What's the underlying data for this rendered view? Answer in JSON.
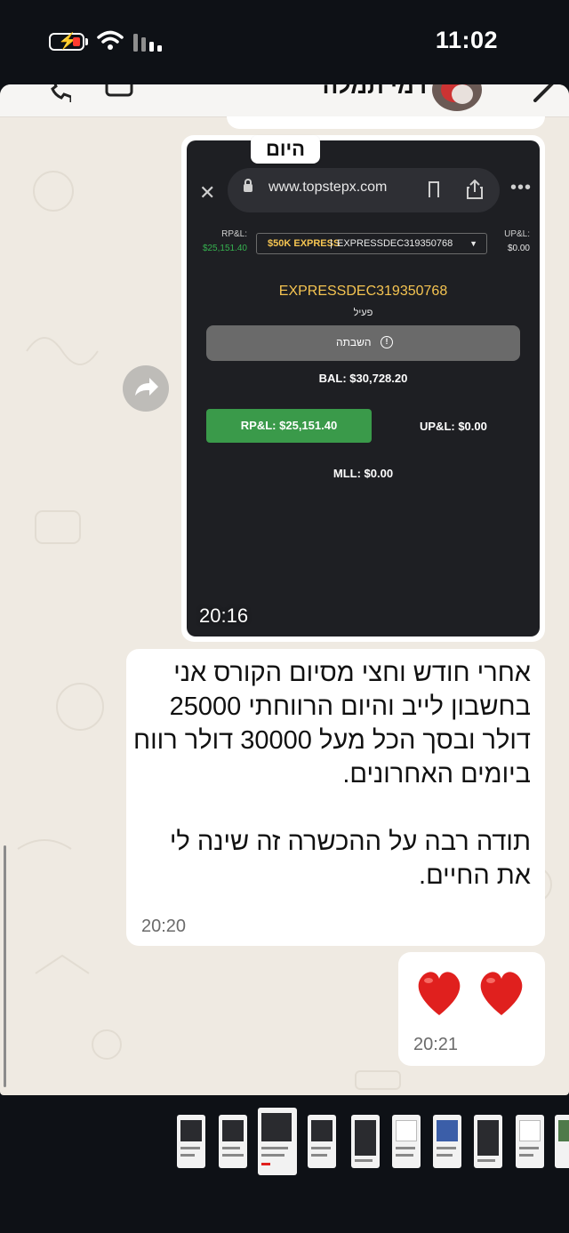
{
  "status_bar": {
    "time": "11:02"
  },
  "chat": {
    "contact_name": "רמי תמלה",
    "date_chip": "היום",
    "image_message": {
      "time": "20:16",
      "browser": {
        "url": "www.topstepx.com"
      },
      "topstep": {
        "rpl_label": "RP&L:",
        "rpl_value": "$25,151.40",
        "upl_label": "UP&L:",
        "upl_value": "$0.00",
        "account_badge": "$50K EXPRESS",
        "account_separator": "|",
        "account_id": "EXPRESSDEC319350768",
        "account_name": "EXPRESSDEC319350768",
        "account_status": "פעיל",
        "pause_label": "השבתה",
        "balance": "BAL: $30,728.20",
        "rpl_button": "RP&L: $25,151.40",
        "upl_main": "UP&L: $0.00",
        "mll": "MLL: $0.00"
      }
    },
    "text_message": {
      "text": "אחרי חודש וחצי מסיום הקורס אני בחשבון לייב והיום הרווחתי 25000 דולר ובסך הכל מעל 30000 דולר רווח ביומים האחרונים.\n\nתודה רבה על ההכשרה זה שינה לי את החיים.",
      "time": "20:20"
    },
    "hearts_message": {
      "content": "❤️❤️",
      "time": "20:21"
    }
  },
  "colors": {
    "accent_gold": "#f5c451",
    "profit_green": "#3a9a4a",
    "chat_bg": "#efeae2"
  },
  "icons": [
    "battery-charging-icon",
    "wifi-icon",
    "signal-icon",
    "call-icon",
    "video-icon",
    "back-chevron-icon",
    "forward-icon",
    "close-icon",
    "lock-icon",
    "bookmark-icon",
    "share-icon",
    "more-icon",
    "info-icon",
    "heart-icon"
  ]
}
